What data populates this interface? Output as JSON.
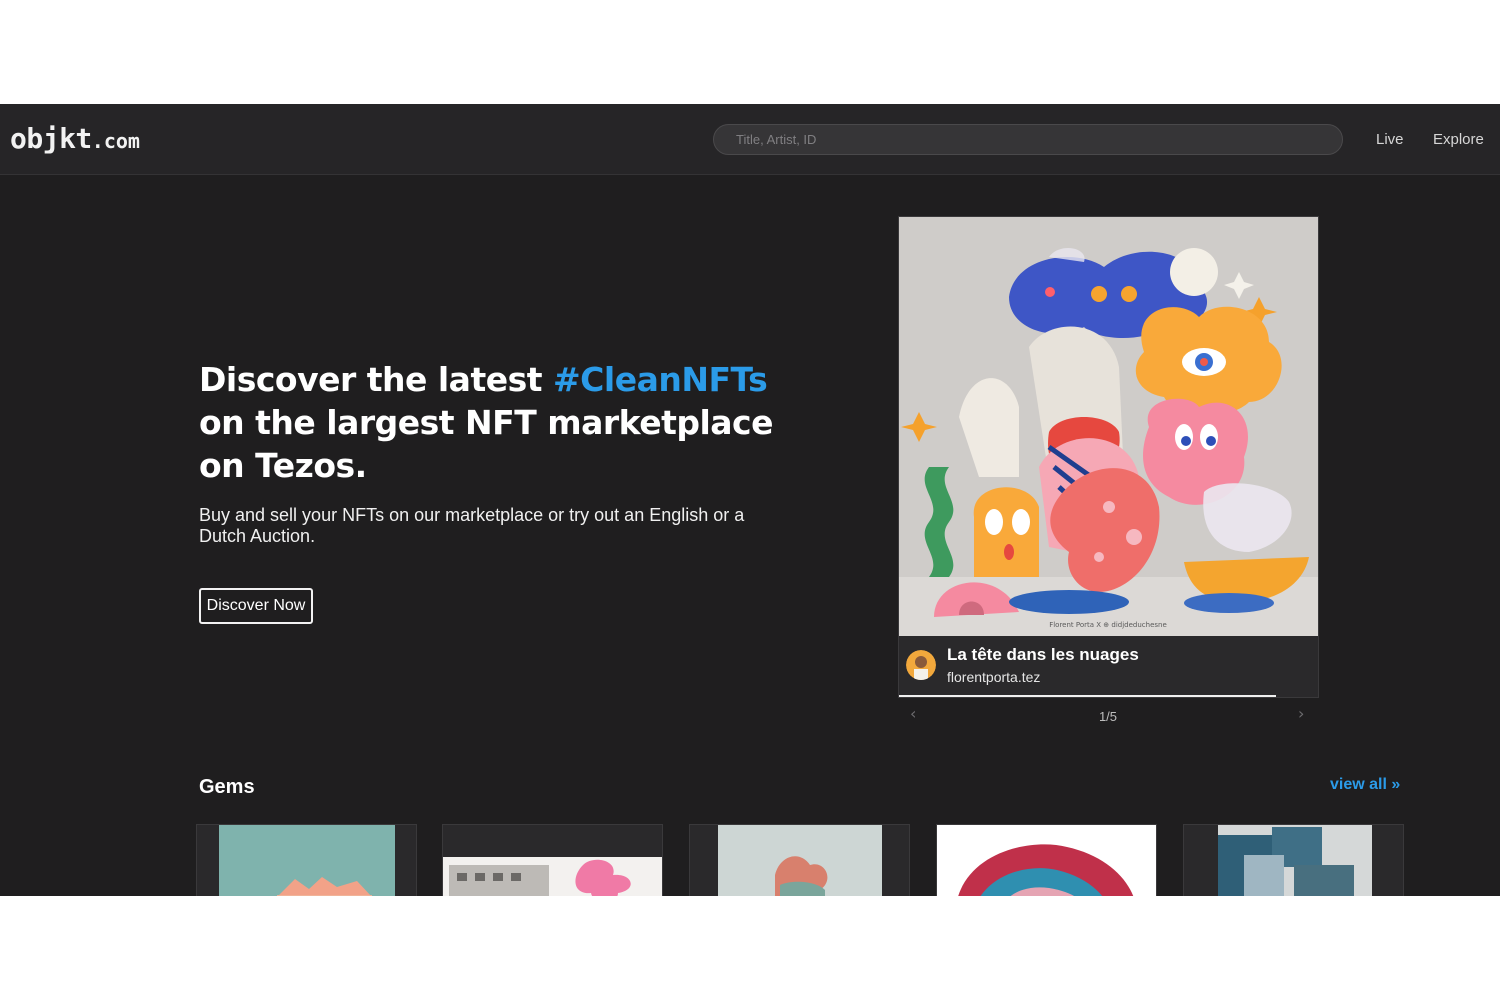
{
  "header": {
    "logo_main": "objkt",
    "logo_domain": ".com",
    "search_placeholder": "Title, Artist, ID",
    "nav": [
      {
        "label": "Live"
      },
      {
        "label": "Explore"
      }
    ]
  },
  "hero": {
    "title_before": "Discover the latest ",
    "title_highlight": "#CleanNFTs",
    "title_after": " on the largest NFT marketplace on Tezos.",
    "subtitle": "Buy and sell your NFTs on our marketplace or try out an English or a Dutch Auction.",
    "cta_label": "Discover Now"
  },
  "featured": {
    "title": "La tête dans les nuages",
    "creator": "florentporta.tez",
    "art_caption": "Florent Porta   X   ⊕ didjdeduchesne",
    "pager": "1/5",
    "prev_icon": "‹",
    "next_icon": "›",
    "progress": 0.9
  },
  "gems": {
    "title": "Gems",
    "view_all": "view all »"
  },
  "colors": {
    "accent": "#2b9be8",
    "background": "#1f1e1f",
    "header": "#262527"
  }
}
